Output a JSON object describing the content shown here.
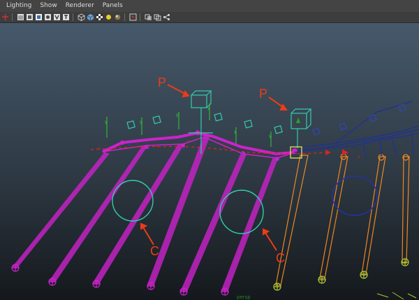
{
  "menubar": {
    "items": [
      "Lighting",
      "Show",
      "Renderer",
      "Panels"
    ]
  },
  "toolbar": {
    "icons": [
      "grab-icon",
      "wireframe-icon",
      "smooth-shade-icon",
      "smooth-shade-all-icon",
      "default-lighting-icon",
      "textured-icon",
      "show-grid-icon",
      "wireframe-cube-icon",
      "shaded-cube-icon",
      "checker-icon",
      "light-bulb-icon",
      "sphere-shade-icon",
      "isolate-select-icon",
      "xray-icon",
      "xray-joints-icon",
      "share-icon"
    ]
  },
  "viewport": {
    "camera_label": "persp",
    "annotations": {
      "p_left": "P",
      "p_right": "P",
      "c_left": "C",
      "c_right": "C"
    },
    "colors": {
      "rig_left": "#cc22cc",
      "rig_right": "#ee8822",
      "controls": "#33ccaa",
      "curve": "#dd2222",
      "deep_blue": "#223388",
      "axis_green": "#33cc33"
    }
  }
}
